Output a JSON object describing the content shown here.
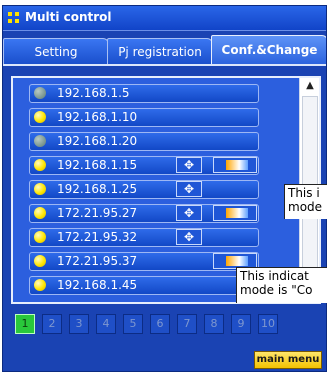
{
  "window": {
    "title": "Multi control"
  },
  "tabs": [
    {
      "label": "Setting",
      "active": false
    },
    {
      "label": "Pj registration",
      "active": false
    },
    {
      "label": "Conf.&Change",
      "active": true
    }
  ],
  "devices": [
    {
      "ip": "192.168.1.5",
      "status": "off",
      "controls": false
    },
    {
      "ip": "192.168.1.10",
      "status": "on",
      "controls": false
    },
    {
      "ip": "192.168.1.20",
      "status": "off",
      "controls": false
    },
    {
      "ip": "192.168.1.15",
      "status": "on",
      "controls": true,
      "gradient": true
    },
    {
      "ip": "192.168.1.25",
      "status": "on",
      "controls": true,
      "gradient": false
    },
    {
      "ip": "172.21.95.27",
      "status": "on",
      "controls": true,
      "gradient": true
    },
    {
      "ip": "172.21.95.32",
      "status": "on",
      "controls": true,
      "gradient": false
    },
    {
      "ip": "172.21.95.37",
      "status": "on",
      "controls": false,
      "gradient": true
    },
    {
      "ip": "192.168.1.45",
      "status": "on",
      "controls": false
    }
  ],
  "pages": [
    "1",
    "2",
    "3",
    "4",
    "5",
    "6",
    "7",
    "8",
    "9",
    "10"
  ],
  "active_page": "1",
  "main_menu_label": "main menu",
  "tooltips": [
    {
      "line1": "This i",
      "line2": "mode"
    },
    {
      "line1": "This indicat",
      "line2": "mode is \"Co"
    }
  ],
  "icons": {
    "move": "four-arrow-move-icon",
    "color": "gradient-bar-icon",
    "title": "grid-icon"
  }
}
